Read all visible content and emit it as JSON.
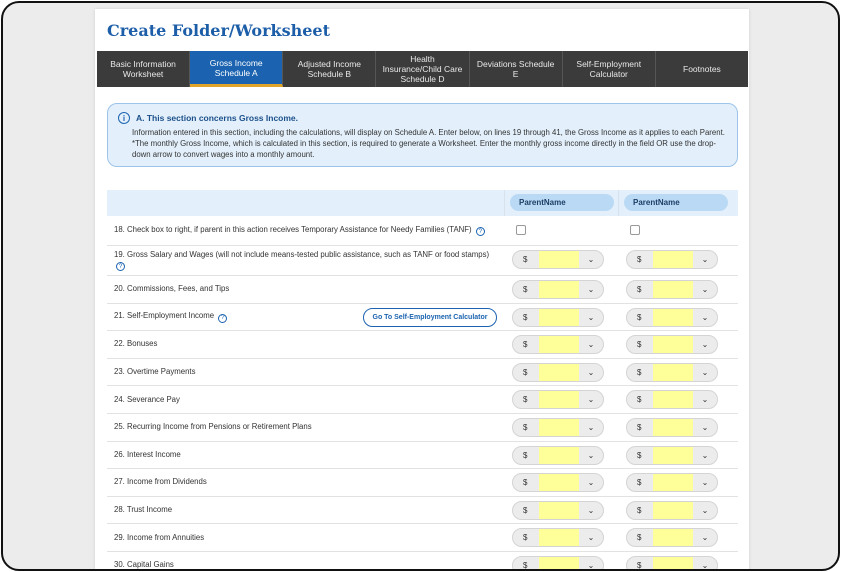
{
  "page": {
    "title": "Create Folder/Worksheet"
  },
  "tabs": [
    {
      "label": "Basic Information Worksheet",
      "active": false
    },
    {
      "label": "Gross Income Schedule A",
      "active": true
    },
    {
      "label": "Adjusted Income Schedule B",
      "active": false
    },
    {
      "label": "Health Insurance/Child Care Schedule D",
      "active": false
    },
    {
      "label": "Deviations Schedule E",
      "active": false
    },
    {
      "label": "Self-Employment Calculator",
      "active": false
    },
    {
      "label": "Footnotes",
      "active": false
    }
  ],
  "info": {
    "icon": "info-icon",
    "title": "A. This section concerns Gross Income.",
    "body": "Information entered in this section, including the calculations, will display on Schedule A. Enter below, on lines 19 through 41, the Gross Income as it applies to each Parent. *The monthly Gross Income, which is calculated in this section, is required to generate a Worksheet. Enter the monthly gross income directly in the field OR use the drop-down arrow to convert wages into a monthly amount."
  },
  "table": {
    "parent1": "ParentName",
    "parent2": "ParentName",
    "currency": "$",
    "self_employment_button": "Go To Self-Employment Calculator",
    "rows": [
      {
        "label": "18. Check box to right, if parent in this action receives Temporary Assistance for Needy Families (TANF)",
        "type": "checkbox",
        "help": true
      },
      {
        "label": "19. Gross Salary and Wages (will not include means-tested public assistance, such as TANF or food stamps)",
        "type": "money",
        "help": true
      },
      {
        "label": "20. Commissions, Fees, and Tips",
        "type": "money",
        "help": false
      },
      {
        "label": "21. Self-Employment Income",
        "type": "money",
        "help": true,
        "button": true
      },
      {
        "label": "22. Bonuses",
        "type": "money",
        "help": false
      },
      {
        "label": "23. Overtime Payments",
        "type": "money",
        "help": false
      },
      {
        "label": "24. Severance Pay",
        "type": "money",
        "help": false
      },
      {
        "label": "25. Recurring Income from Pensions or Retirement Plans",
        "type": "money",
        "help": false
      },
      {
        "label": "26. Interest Income",
        "type": "money",
        "help": false
      },
      {
        "label": "27. Income from Dividends",
        "type": "money",
        "help": false
      },
      {
        "label": "28. Trust Income",
        "type": "money",
        "help": false
      },
      {
        "label": "29. Income from Annuities",
        "type": "money",
        "help": false
      },
      {
        "label": "30. Capital Gains",
        "type": "money",
        "help": false
      }
    ]
  },
  "colors": {
    "accent": "#1b63b0",
    "tab_bg": "#3b3b3b",
    "highlight": "#ffff99",
    "active_underline": "#e0a42a"
  }
}
